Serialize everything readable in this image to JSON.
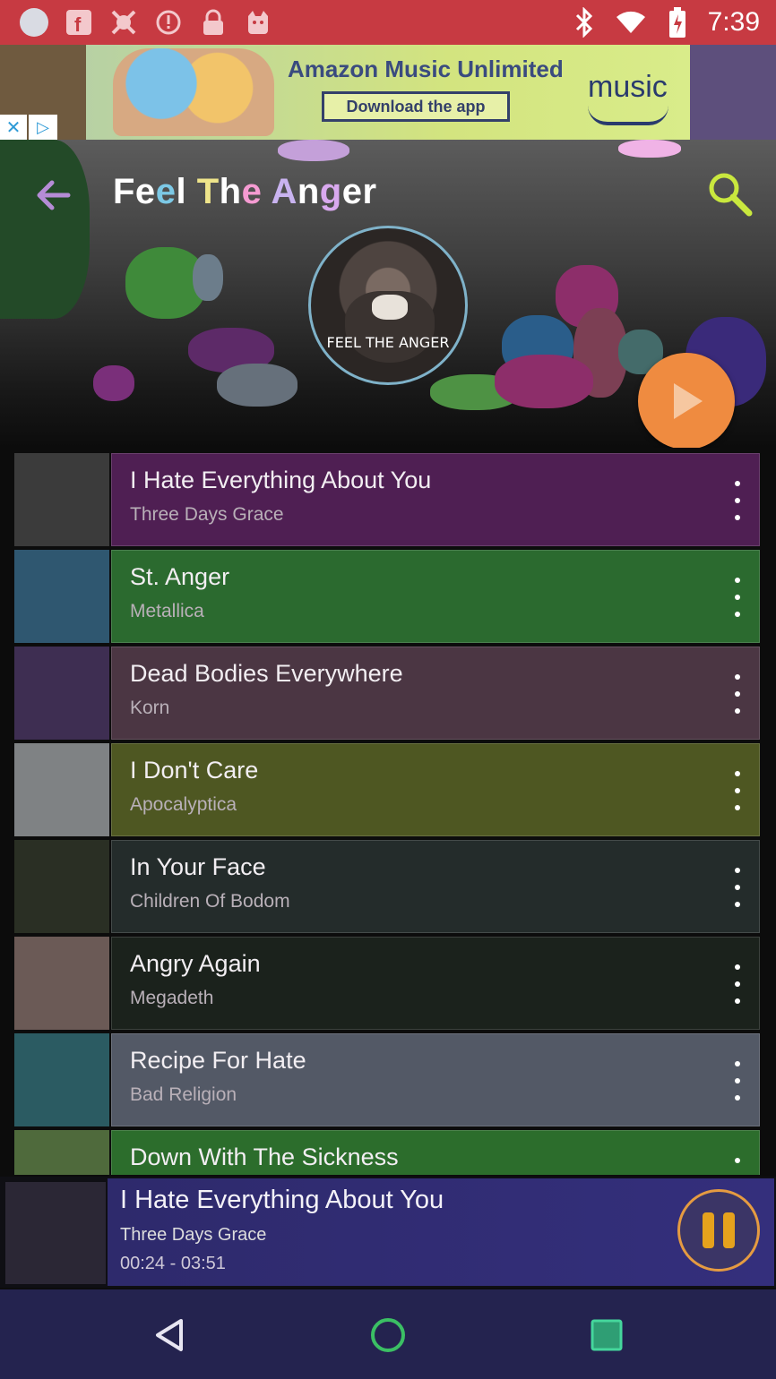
{
  "status_bar": {
    "time": "7:39",
    "left_icons": [
      "circle-icon",
      "facebook-icon",
      "fake-gps-icon",
      "alert-icon",
      "lock-icon",
      "cat-icon"
    ],
    "right_icons": [
      "bluetooth-icon",
      "wifi-icon",
      "battery-icon"
    ]
  },
  "ad": {
    "title": "Amazon Music Unlimited",
    "cta": "Download the app",
    "brand": "music"
  },
  "header": {
    "title_letters": [
      "Fe",
      "e",
      "l",
      " ",
      "T",
      "h",
      "e",
      " ",
      "A",
      "n",
      "g",
      "er"
    ],
    "title": "Feel The Anger",
    "cover_text": "FEEL THE ANGER"
  },
  "songs": [
    {
      "title": "I Hate Everything About You",
      "artist": "Three Days Grace",
      "color": "#4f1f53"
    },
    {
      "title": "St. Anger",
      "artist": "Metallica",
      "color": "#2b6a2f"
    },
    {
      "title": "Dead Bodies Everywhere",
      "artist": "Korn",
      "color": "#4b3643"
    },
    {
      "title": "I Don't Care",
      "artist": "Apocalyptica",
      "color": "#4e5722"
    },
    {
      "title": "In Your Face",
      "artist": "Children Of Bodom",
      "color": "#242c2b"
    },
    {
      "title": "Angry Again",
      "artist": "Megadeth",
      "color": "#1b221c"
    },
    {
      "title": "Recipe For Hate",
      "artist": "Bad Religion",
      "color": "#535966"
    },
    {
      "title": "Down With The Sickness",
      "artist": "",
      "color": "#2c6d2c"
    }
  ],
  "now_playing": {
    "title": "I Hate Everything About You",
    "artist": "Three Days Grace",
    "time": "00:24 - 03:51",
    "accent": "#e5a21d"
  },
  "nav": {
    "back_icon": "triangle-back-icon",
    "home_icon": "circle-home-icon",
    "recents_icon": "square-recents-icon"
  }
}
